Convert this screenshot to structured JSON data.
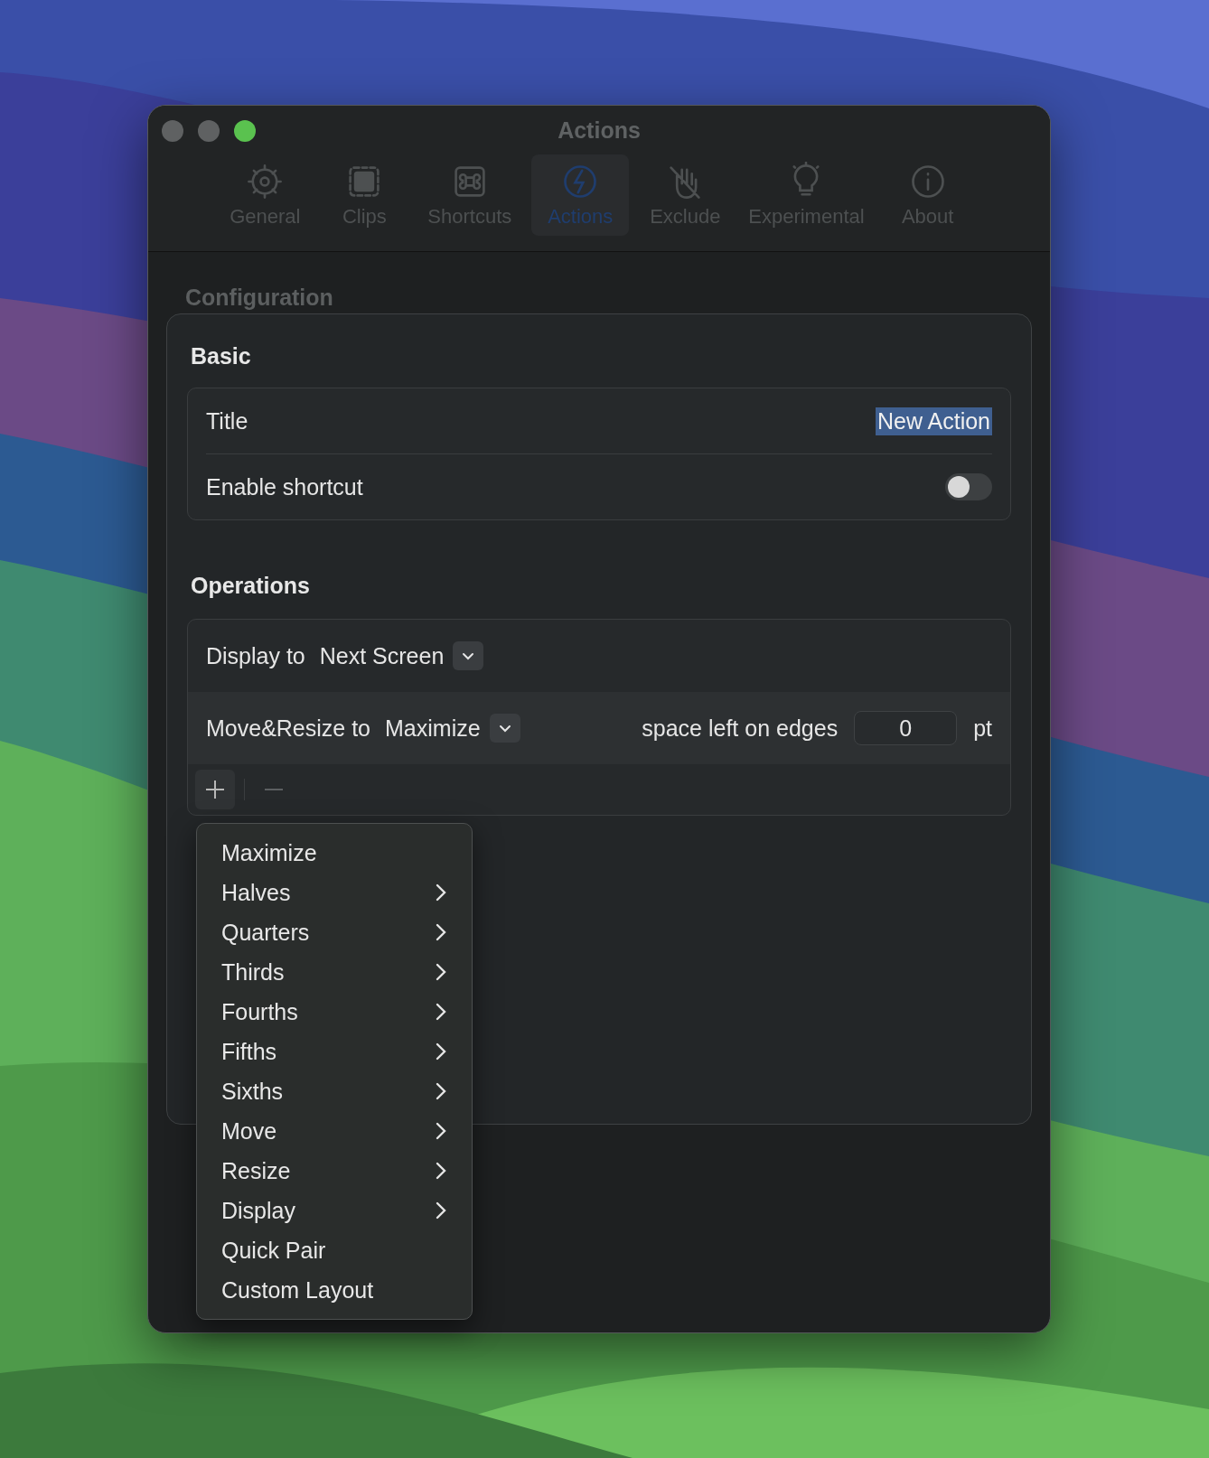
{
  "window": {
    "title": "Actions"
  },
  "toolbar": {
    "tabs": [
      {
        "label": "General",
        "selected": false
      },
      {
        "label": "Clips",
        "selected": false
      },
      {
        "label": "Shortcuts",
        "selected": false
      },
      {
        "label": "Actions",
        "selected": true
      },
      {
        "label": "Exclude",
        "selected": false
      },
      {
        "label": "Experimental",
        "selected": false
      },
      {
        "label": "About",
        "selected": false
      }
    ]
  },
  "section_title": "Configuration",
  "basic": {
    "title": "Basic",
    "title_row": {
      "label": "Title",
      "value": "New Action",
      "value_selected": true
    },
    "shortcut_row": {
      "label": "Enable shortcut",
      "on": false
    }
  },
  "operations": {
    "title": "Operations",
    "rows": [
      {
        "kind": "display",
        "label": "Display to",
        "value": "Next Screen"
      },
      {
        "kind": "move",
        "label": "Move&Resize to",
        "value": "Maximize",
        "extra_label": "space left on edges",
        "field_value": "0",
        "unit": "pt"
      }
    ],
    "add_disabled": false,
    "remove_disabled": true
  },
  "menu": {
    "items": [
      {
        "label": "Maximize",
        "submenu": false
      },
      {
        "label": "Halves",
        "submenu": true
      },
      {
        "label": "Quarters",
        "submenu": true
      },
      {
        "label": "Thirds",
        "submenu": true
      },
      {
        "label": "Fourths",
        "submenu": true
      },
      {
        "label": "Fifths",
        "submenu": true
      },
      {
        "label": "Sixths",
        "submenu": true
      },
      {
        "label": "Move",
        "submenu": true
      },
      {
        "label": "Resize",
        "submenu": true
      },
      {
        "label": "Display",
        "submenu": true
      },
      {
        "label": "Quick Pair",
        "submenu": false
      },
      {
        "label": "Custom Layout",
        "submenu": false
      }
    ]
  }
}
